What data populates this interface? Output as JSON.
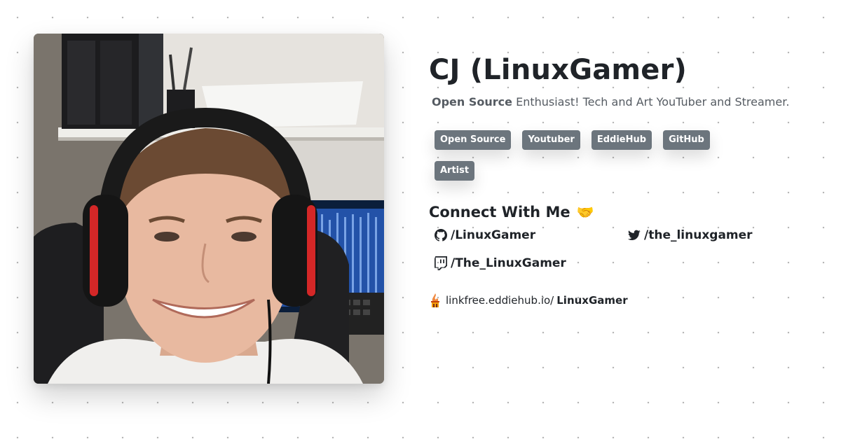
{
  "profile": {
    "name": "CJ (LinuxGamer)",
    "bio_bold": "Open Source",
    "bio_rest": "Enthusiast! Tech and Art YouTuber and Streamer."
  },
  "tags": [
    "Open Source",
    "Youtuber",
    "EddieHub",
    "GitHub",
    "Artist"
  ],
  "connect": {
    "title": "Connect With Me",
    "emoji": "🤝"
  },
  "socials": {
    "github": {
      "icon": "github-icon",
      "handle": "/LinuxGamer"
    },
    "twitter": {
      "icon": "twitter-icon",
      "handle": "/the_linuxgamer"
    },
    "twitch": {
      "icon": "twitch-icon",
      "handle": "/The_LinuxGamer"
    }
  },
  "linkfree": {
    "icon": "linkfree-logo-icon",
    "base": "linkfree.eddiehub.io/",
    "handle": "LinuxGamer"
  },
  "colors": {
    "tag_bg": "#6c757d",
    "text": "#1f2328",
    "muted": "#555b62"
  }
}
